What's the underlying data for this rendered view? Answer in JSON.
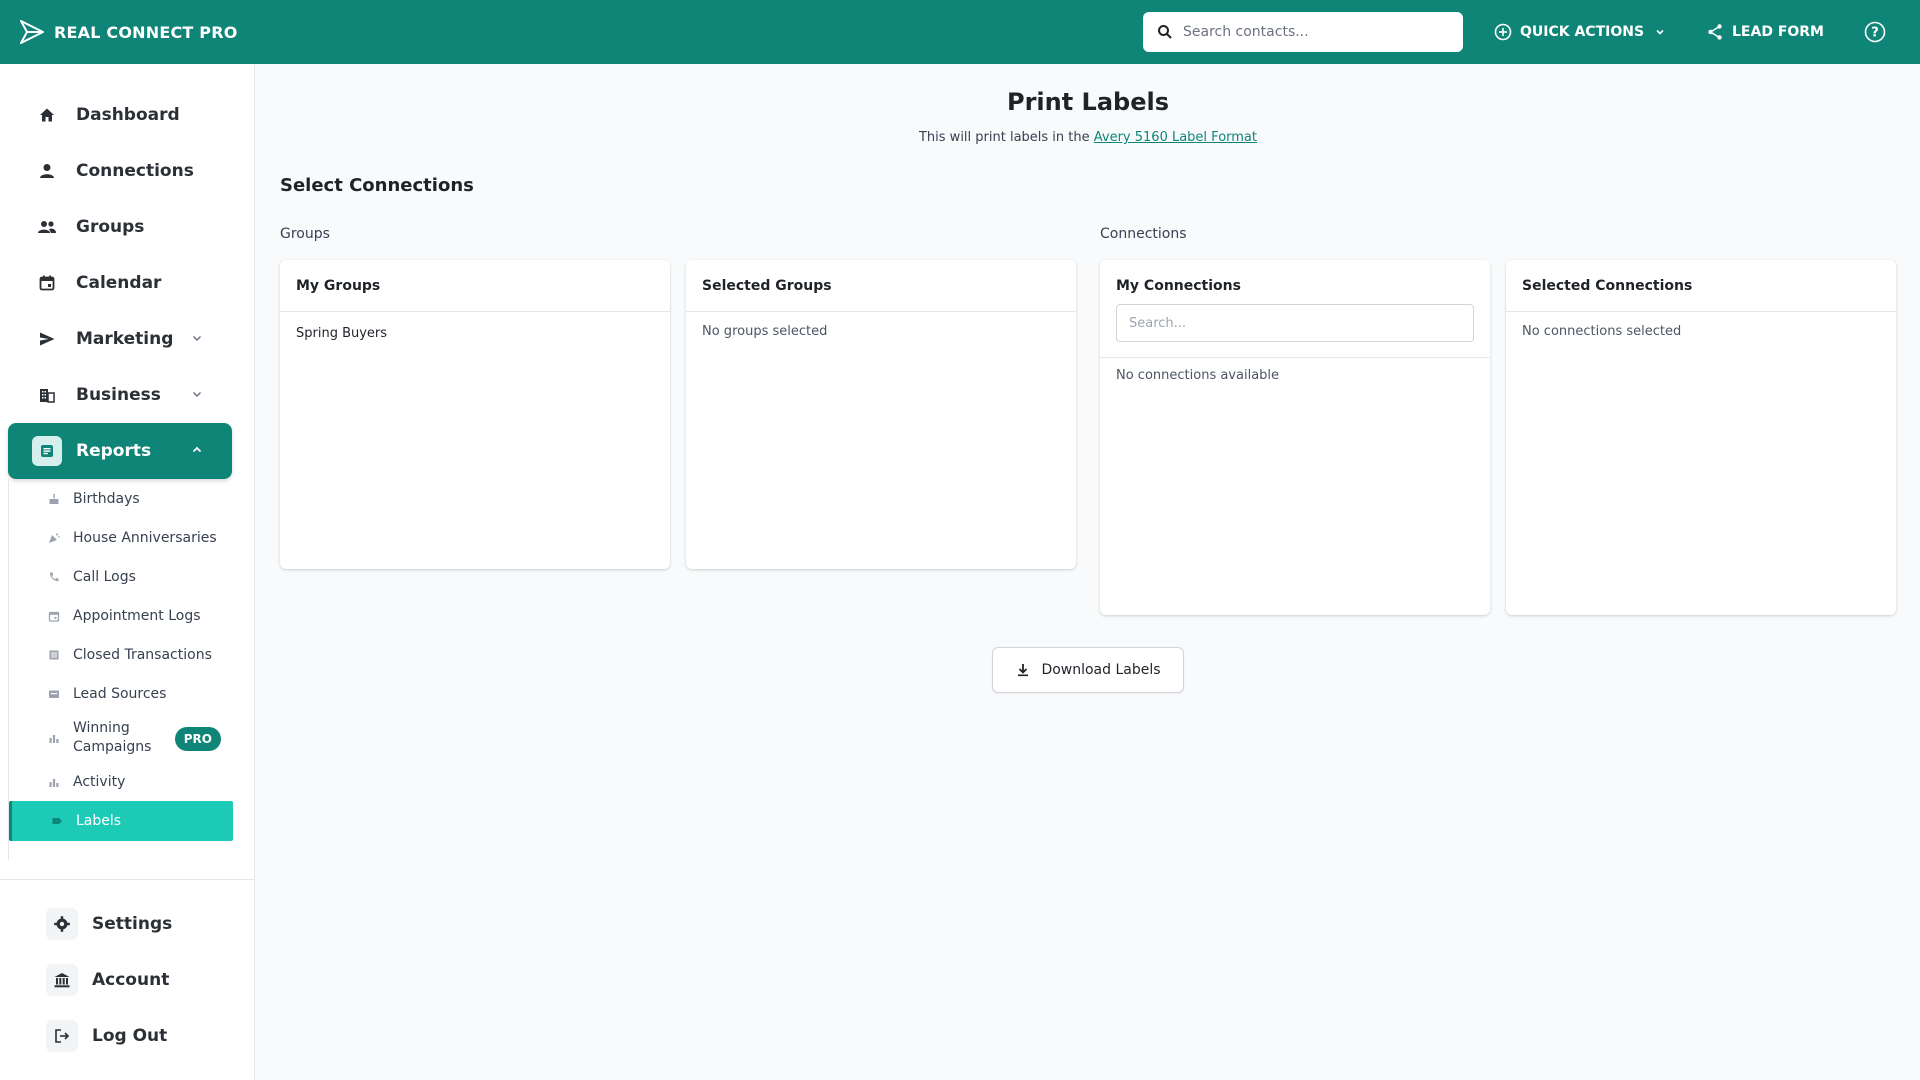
{
  "app": {
    "name": "REAL CONNECT PRO"
  },
  "topbar": {
    "search_placeholder": "Search contacts...",
    "quick_actions_label": "QUICK ACTIONS",
    "lead_form_label": "LEAD FORM"
  },
  "sidebar": {
    "items": [
      {
        "label": "Dashboard",
        "icon": "home-icon"
      },
      {
        "label": "Connections",
        "icon": "person-icon"
      },
      {
        "label": "Groups",
        "icon": "people-icon"
      },
      {
        "label": "Calendar",
        "icon": "calendar-icon"
      },
      {
        "label": "Marketing",
        "icon": "send-icon",
        "expandable": true
      },
      {
        "label": "Business",
        "icon": "building-icon",
        "expandable": true
      },
      {
        "label": "Reports",
        "icon": "report-icon",
        "expandable": true,
        "active": true
      }
    ],
    "reports_sub": [
      {
        "label": "Birthdays",
        "icon": "cake-icon"
      },
      {
        "label": "House Anniversaries",
        "icon": "celebration-icon"
      },
      {
        "label": "Call Logs",
        "icon": "phone-icon"
      },
      {
        "label": "Appointment Logs",
        "icon": "calendar-small-icon"
      },
      {
        "label": "Closed Transactions",
        "icon": "receipt-icon"
      },
      {
        "label": "Lead Sources",
        "icon": "inbox-icon"
      },
      {
        "label_line1": "Winning",
        "label_line2": "Campaigns",
        "icon": "bar-chart-icon",
        "badge": "PRO"
      },
      {
        "label": "Activity",
        "icon": "bar-chart-icon"
      },
      {
        "label": "Labels",
        "icon": "label-icon",
        "active": true
      }
    ],
    "bottom": [
      {
        "label": "Settings",
        "icon": "gear-icon"
      },
      {
        "label": "Account",
        "icon": "bank-icon"
      },
      {
        "label": "Log Out",
        "icon": "logout-icon"
      }
    ]
  },
  "main": {
    "title": "Print Labels",
    "subtitle_prefix": "This will print labels in the ",
    "subtitle_link": "Avery 5160 Label Format",
    "section_title": "Select Connections",
    "groups_label": "Groups",
    "connections_label": "Connections",
    "cards": {
      "my_groups": {
        "title": "My Groups",
        "items": [
          "Spring Buyers"
        ]
      },
      "selected_groups": {
        "title": "Selected Groups",
        "empty": "No groups selected"
      },
      "my_connections": {
        "title": "My Connections",
        "search_placeholder": "Search...",
        "empty": "No connections available"
      },
      "selected_connections": {
        "title": "Selected Connections",
        "empty": "No connections selected"
      }
    },
    "download_label": "Download Labels"
  },
  "colors": {
    "brand": "#0f8578",
    "active_sub": "#1ccab6"
  }
}
